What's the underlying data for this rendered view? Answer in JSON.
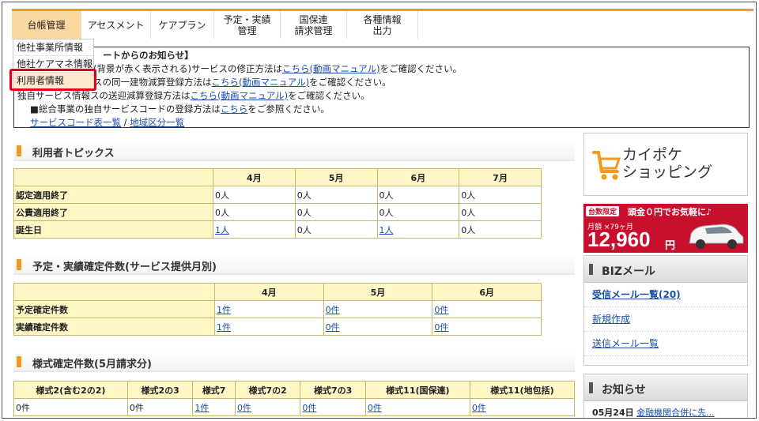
{
  "nav": [
    {
      "label": "台帳管理",
      "active": true
    },
    {
      "label": "アセスメント"
    },
    {
      "label": "ケアプラン"
    },
    {
      "label": "予定・実績\n管理"
    },
    {
      "label": "国保連\n請求管理"
    },
    {
      "label": "各種情報\n出力"
    }
  ],
  "dropdown": [
    "他社事業所情報",
    "他社ケアマネ情報",
    "利用者情報"
  ],
  "notice": {
    "title": "ートからのお知らせ】",
    "line1_pre": "(背景が赤く表示される)サービスの修正方法は",
    "line1_link": "こちら(動画マニュアル)",
    "line1_post": "をご確認ください。",
    "line2_pre": "スの同一建物減算登録方法は",
    "line2_link": "こちら(動画マニュアル)",
    "line2_post": "をご確認ください。",
    "line3_pre": "独自サービス情報",
    "line3_mid": "スの送迎減算登録方法は",
    "line3_link": "こちら(動画マニュアル)",
    "line3_post": "をご確認ください。",
    "line4_pre": "■総合事業の独自サービスコードの登録方法は",
    "line4_link": "こちら",
    "line4_post": "をご参照ください。",
    "link_a": "サービスコード表一覧",
    "sep": "/",
    "link_b": "地域区分一覧"
  },
  "topics": {
    "title": "利用者トピックス",
    "headers": [
      "4月",
      "5月",
      "6月",
      "7月"
    ],
    "rows": [
      {
        "label": "認定適用終了",
        "cells": [
          "0人",
          "0人",
          "0人",
          "0人"
        ]
      },
      {
        "label": "公費適用終了",
        "cells": [
          "0人",
          "0人",
          "0人",
          "0人"
        ]
      },
      {
        "label": "誕生日",
        "cells": [
          "1人",
          "0人",
          "1人",
          "0人"
        ]
      }
    ]
  },
  "confirm": {
    "title": "予定・実績確定件数(サービス提供月別)",
    "headers": [
      "4月",
      "5月",
      "6月"
    ],
    "rows": [
      {
        "label": "予定確定件数",
        "cells": [
          "1件",
          "0件",
          "0件"
        ]
      },
      {
        "label": "実績確定件数",
        "cells": [
          "1件",
          "0件",
          "0件"
        ]
      }
    ]
  },
  "forms": {
    "title": "様式確定件数(5月請求分)",
    "headers": [
      "様式2(含む2の2)",
      "様式2の3",
      "様式7",
      "様式7の2",
      "様式7の3",
      "様式11(国保連)",
      "様式11(地包括)"
    ],
    "cells": [
      "0件",
      "0件",
      "1件",
      "0件",
      "0件",
      "0件",
      "0件"
    ]
  },
  "shop": {
    "line1": "カイポケ",
    "line2": "ショッピング"
  },
  "banner": {
    "badge": "台数限定",
    "top": "頭金０円でお気軽に♪",
    "sub": "月額 ×79ヶ月",
    "price": "12,960",
    "yen": "円"
  },
  "biz": {
    "title": "BIZメール",
    "links": [
      "受信メール一覧(20)",
      "新規作成",
      "送信メール一覧"
    ]
  },
  "news": {
    "title": "お知らせ",
    "date": "05月24日",
    "item": "金融機関合併に先..."
  },
  "colors": {
    "accent": "#f39a1c",
    "nav_active": "#fbd8a0",
    "highlight": "#e0001b",
    "table_head": "#fff6c6"
  }
}
